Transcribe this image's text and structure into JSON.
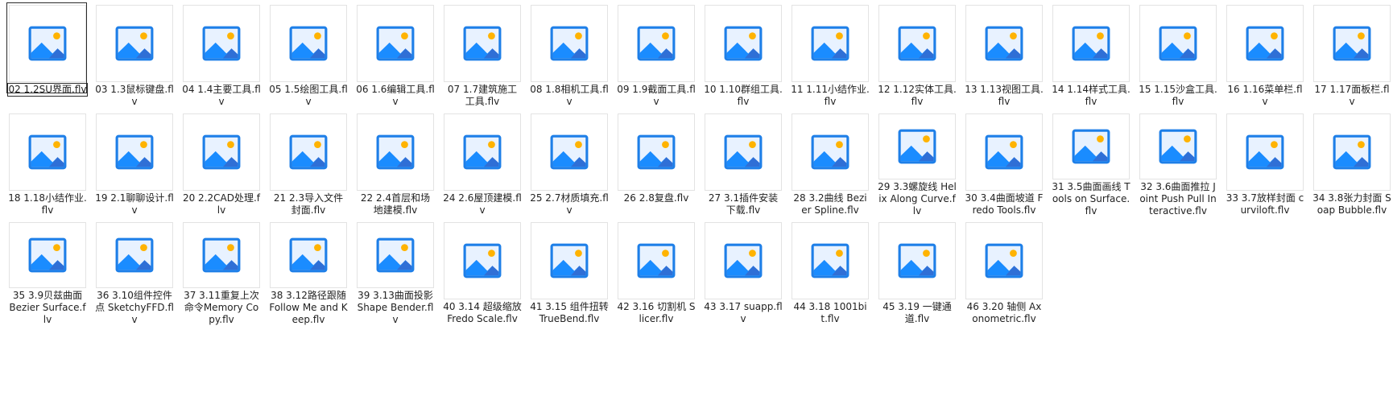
{
  "colors": {
    "icon_sky": "#e8f2ff",
    "icon_frame": "#1e7fe8",
    "icon_mountain_back": "#2f6fd6",
    "icon_mountain_front": "#1a8cff",
    "icon_sun": "#ffb300",
    "selection_border": "#2a2a2a"
  },
  "files": [
    {
      "name": "02 1.2SU界面.flv",
      "selected": true
    },
    {
      "name": "03 1.3鼠标键盘.flv"
    },
    {
      "name": "04 1.4主要工具.flv"
    },
    {
      "name": "05 1.5绘图工具.flv"
    },
    {
      "name": "06 1.6编辑工具.flv"
    },
    {
      "name": "07 1.7建筑施工工具.flv"
    },
    {
      "name": "08 1.8相机工具.flv"
    },
    {
      "name": "09 1.9截面工具.flv"
    },
    {
      "name": "10 1.10群组工具.flv"
    },
    {
      "name": "11 1.11小结作业.flv"
    },
    {
      "name": "12 1.12实体工具.flv"
    },
    {
      "name": "13 1.13视图工具.flv"
    },
    {
      "name": "14 1.14样式工具.flv"
    },
    {
      "name": "15 1.15沙盒工具.flv"
    },
    {
      "name": "16 1.16菜单栏.flv"
    },
    {
      "name": "17 1.17面板栏.flv"
    },
    {
      "name": "18 1.18小结作业.flv"
    },
    {
      "name": "19 2.1聊聊设计.flv"
    },
    {
      "name": "20 2.2CAD处理.flv"
    },
    {
      "name": "21 2.3导入文件封面.flv"
    },
    {
      "name": "22 2.4首层和场地建模.flv"
    },
    {
      "name": "24 2.6屋顶建模.flv"
    },
    {
      "name": "25 2.7材质填充.flv"
    },
    {
      "name": "26 2.8复盘.flv"
    },
    {
      "name": "27 3.1插件安装下载.flv"
    },
    {
      "name": "28 3.2曲线 Bezier Spline.flv"
    },
    {
      "name": "29 3.3螺旋线 Helix Along Curve.flv"
    },
    {
      "name": "30 3.4曲面坡道 Fredo Tools.flv"
    },
    {
      "name": "31 3.5曲面画线 Tools on Surface.flv"
    },
    {
      "name": "32 3.6曲面推拉 Joint Push Pull Interactive.flv"
    },
    {
      "name": "33 3.7放样封面 curviloft.flv"
    },
    {
      "name": "34 3.8张力封面 Soap Bubble.flv"
    },
    {
      "name": "35 3.9贝兹曲面 Bezier Surface.flv"
    },
    {
      "name": "36 3.10组件控件点 SketchyFFD.flv"
    },
    {
      "name": "37 3.11重复上次命令Memory Copy.flv"
    },
    {
      "name": "38 3.12路径跟随 Follow Me and Keep.flv"
    },
    {
      "name": "39 3.13曲面投影 Shape Bender.flv"
    },
    {
      "name": "40 3.14 超级缩放Fredo Scale.flv"
    },
    {
      "name": "41 3.15 组件扭转TrueBend.flv"
    },
    {
      "name": "42 3.16 切割机 Slicer.flv"
    },
    {
      "name": "43 3.17 suapp.flv"
    },
    {
      "name": "44 3.18 1001bit.flv"
    },
    {
      "name": "45 3.19 一键通道.flv"
    },
    {
      "name": "46 3.20 轴侧 Axonometric.flv"
    }
  ]
}
